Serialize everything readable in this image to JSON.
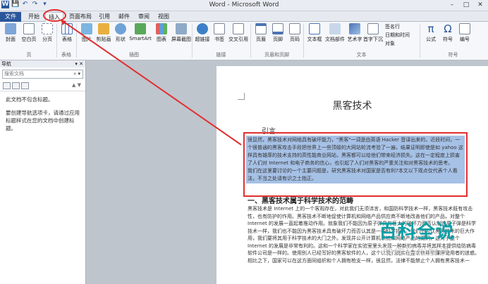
{
  "window": {
    "title": "Word - Microsoft Word"
  },
  "quick_access": [
    "W",
    "💾",
    "↶",
    "↷",
    "▾"
  ],
  "tabs": [
    "文件",
    "开始",
    "插入",
    "页面布局",
    "引用",
    "邮件",
    "审阅",
    "视图"
  ],
  "ribbon": {
    "buttons": [
      "封面",
      "空白页",
      "分页",
      "表格",
      "图片",
      "剪贴画",
      "形状",
      "SmartArt",
      "图表",
      "屏幕截图",
      "超链接",
      "书签",
      "交叉引用",
      "页眉",
      "页脚",
      "页码",
      "文本框",
      "文档部件",
      "艺术字",
      "首字下沉",
      "公式",
      "符号",
      "编号"
    ],
    "small": [
      "签名行",
      "日期和时间",
      "对象"
    ],
    "groups": [
      "页",
      "表格",
      "插图",
      "链接",
      "页眉和页脚",
      "文本",
      "符号"
    ]
  },
  "nav": {
    "header": "导航",
    "search_placeholder": "搜索文档",
    "msg1": "此文档不包含标题。",
    "msg2": "要创建导航选项卡，请通过应用标题样式在您的文档中创建标题。"
  },
  "doc": {
    "title": "黑客技术",
    "intro": "引言",
    "para1": "很显然，黑客技术对网络具有破坏能力，\"黑客\"一词是由英语 Hacker 音译出来的，近段时间，一个很普通的黑客攻击手段把世界上一些顶级的大网站轮流考验了一遍，结果证明即使是如 yahoo 这样具有雄厚的技术支持的高性能商业网站，黑客都可以给他们带来经济损失。这在一定程度上损害了人们对 Internet 和电子商务的信心，也引起了人们对黑客的严重关注和对黑客技术的思考。",
    "para2": "我们在这里要讨论的一个主要问题是，研究黑客技术对国家是否有利?本文以下观点仅代表个人看法，不当之处请有识之士指正。",
    "h1": "一、黑客技术属于科学技术的范畴",
    "body": "黑客技术是 Internet 上的一个客观存在，对此我们无须讳言，和国防科学技术一样，黑客技术既有攻击性，也有防护的作用。黑客技术不断地促使计算机和网络产品供应商不断地改善他们的产品，对整个 Internet 的发展一直起着推动作用。就象我们不能因为原子弹具有巨大的破坏力而否认制造原子弹是科学技术一样，我们也不能因为黑客技术具有破坏力而否认其是一种科学技术。我们不否认黑客技术的巨大作用，我们要将其用于科学技术的大门之外。发现并公开计算机系统和网络产品的漏洞，这对于整个 Internet 的发展是非常有利的。这和一个科学家在实验室里头发现一种新的病毒并将其样本提供给防病毒软件公司是一样的。使用别人已经写好的黑客软件的人，这个让我们说实在要求他非常懂得使用者的迷惑。相比之下，国家可以在这方面同组织和个人拥有枪支一样，很显然，法律不能禁止个人拥有黑客技术一"
  },
  "watermark": {
    "line1": "百科全说",
    "line2": "助你轻松解决"
  }
}
